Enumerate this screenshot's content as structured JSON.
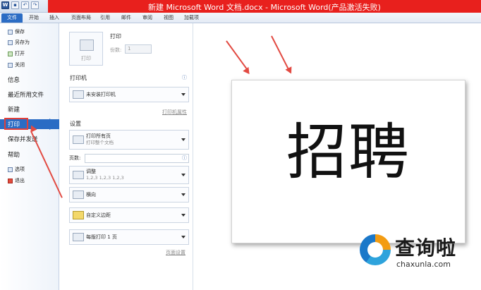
{
  "title_bar": {
    "title": "新建 Microsoft Word 文档.docx - Microsoft Word(产品激活失败)",
    "qat_icons": [
      "word-app-icon",
      "save-icon",
      "undo-icon",
      "redo-icon"
    ]
  },
  "ribbon_tabs": [
    "文件",
    "开始",
    "插入",
    "页面布局",
    "引用",
    "邮件",
    "审阅",
    "视图",
    "加载项"
  ],
  "backstage_nav": {
    "save": "保存",
    "save_as": "另存为",
    "open": "打开",
    "close": "关闭",
    "info": "信息",
    "recent": "最近所用文件",
    "new": "新建",
    "print": "打印",
    "save_send": "保存并发送",
    "help": "帮助",
    "options": "选项",
    "exit": "退出"
  },
  "print_panel": {
    "print_button_label": "打印",
    "print_title": "打印",
    "copies_label": "份数:",
    "copies_value": "1",
    "printer_section": "打印机",
    "printer_name": "未安装打印机",
    "printer_properties": "打印机属性",
    "settings_section": "设置",
    "print_range": "打印所有页",
    "print_range_sub": "打印整个文档",
    "pages_label": "页数:",
    "collate": "调整",
    "collate_sub": "1,2,3   1,2,3   1,2,3",
    "orientation": "横向",
    "margins": "自定义边距",
    "per_sheet": "每版打印 1 页",
    "page_setup": "页面设置"
  },
  "preview": {
    "document_text": "招聘"
  },
  "watermark": {
    "title": "查询啦",
    "url": "chaxunla.com"
  },
  "colors": {
    "accent": "#2b6cc4",
    "title_red": "#e8201d",
    "annotation_red": "#e24a42"
  }
}
